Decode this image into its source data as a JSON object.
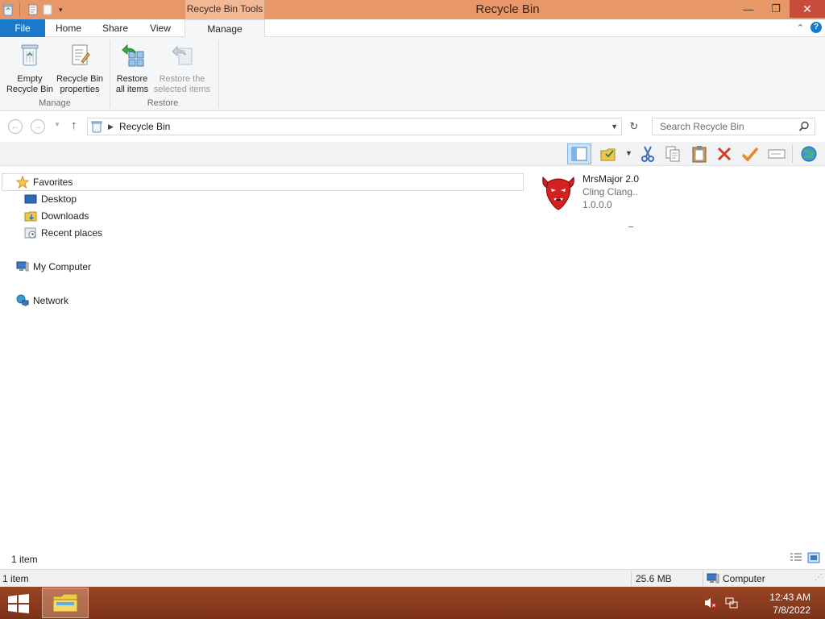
{
  "window": {
    "title": "Recycle Bin",
    "context_tab": "Recycle Bin Tools",
    "close_glyph": "✕",
    "maximize_glyph": "❐",
    "minimize_glyph": "—"
  },
  "ribbon": {
    "tabs": {
      "file": "File",
      "home": "Home",
      "share": "Share",
      "view": "View",
      "manage": "Manage"
    },
    "buttons": {
      "empty_l1": "Empty",
      "empty_l2": "Recycle Bin",
      "props_l1": "Recycle Bin",
      "props_l2": "properties",
      "restore_all_l1": "Restore",
      "restore_all_l2": "all items",
      "restore_sel_l1": "Restore the",
      "restore_sel_l2": "selected items"
    },
    "groups": {
      "manage": "Manage",
      "restore": "Restore"
    }
  },
  "address": {
    "path": "Recycle Bin",
    "search_placeholder": "Search Recycle Bin"
  },
  "nav": {
    "favorites": "Favorites",
    "desktop": "Desktop",
    "downloads": "Downloads",
    "recent": "Recent places",
    "computer": "My Computer",
    "network": "Network"
  },
  "item": {
    "name": "MrsMajor 2.0",
    "company": "Cling Clang..",
    "version": "1.0.0.0"
  },
  "footer": {
    "item_count": "1 item"
  },
  "status": {
    "items": "1 item",
    "size": "25.6 MB",
    "location": "Computer"
  },
  "clock": {
    "time": "12:43 AM",
    "date": "7/8/2022"
  },
  "colors": {
    "titlebar": "#e89868",
    "accent": "#1979ca",
    "taskbar": "#8a3a1f"
  }
}
